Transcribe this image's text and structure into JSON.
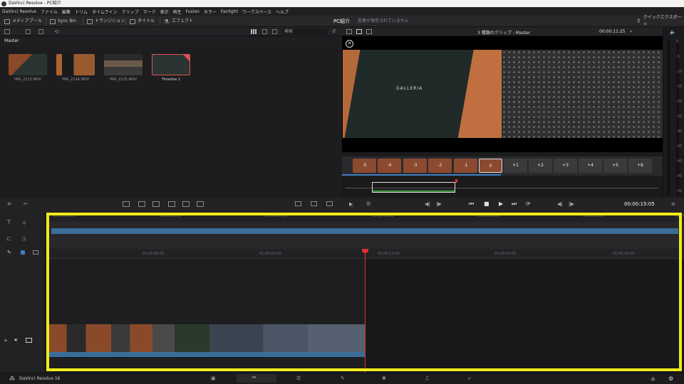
{
  "window": {
    "title": "DaVinci Resolve - PC紹介"
  },
  "menu": [
    "DaVinci Resolve",
    "ファイル",
    "編集",
    "トリム",
    "タイムライン",
    "クリップ",
    "マーク",
    "表示",
    "再生",
    "Fusion",
    "カラー",
    "Fairlight",
    "ワークスペース",
    "ヘルプ"
  ],
  "toolbar": {
    "media_pool": "メディアプール",
    "sync_bin": "Sync Bin",
    "transitions": "トランジション",
    "titles": "タイトル",
    "effects": "エフェクト",
    "project_name": "PC紹介",
    "save_status": "変更が保存されていません",
    "quick_export": "クイックエクスポート"
  },
  "media_pool": {
    "search_label": "検索",
    "bin": "Master",
    "clips": [
      {
        "name": "IMG_2123.MOV"
      },
      {
        "name": "IMG_2124.MOV"
      },
      {
        "name": "IMG_2125.MOV"
      },
      {
        "name": "Timeline 1"
      }
    ]
  },
  "viewer": {
    "title": "3 種類のクリップ - Master",
    "timecode": "00:00:11:25",
    "playhead_timecode": "00:00:15:05",
    "brand_text": "GALLERIA",
    "frames": [
      "-5",
      "-4",
      "-3",
      "-2",
      "-1",
      "0",
      "+1",
      "+2",
      "+3",
      "+4",
      "+5",
      "+6"
    ],
    "meter_labels": [
      "0",
      "-5",
      "-10",
      "-15",
      "-20",
      "-25",
      "-30",
      "-35",
      "-40",
      "-45",
      "-50"
    ]
  },
  "timeline": {
    "upper_ruler": [
      "01:00:00:00",
      "01:00:02:00",
      "01:00:04:00",
      "01:00:06:00",
      "01:00:08:00",
      "01:00:10:00",
      "01:00:12:00"
    ],
    "lower_ruler": [
      "01:00:08:00",
      "01:00:10:00",
      "01:00:12:00",
      "01:00:14:00",
      "01:00:16:00"
    ]
  },
  "status": {
    "app_version": "DaVinci Resolve 16"
  },
  "colors": {
    "accent": "#3f7fbf",
    "playhead": "#e0302f",
    "highlight": "#f2ea1b",
    "clip_blue": "#3a6e99"
  }
}
